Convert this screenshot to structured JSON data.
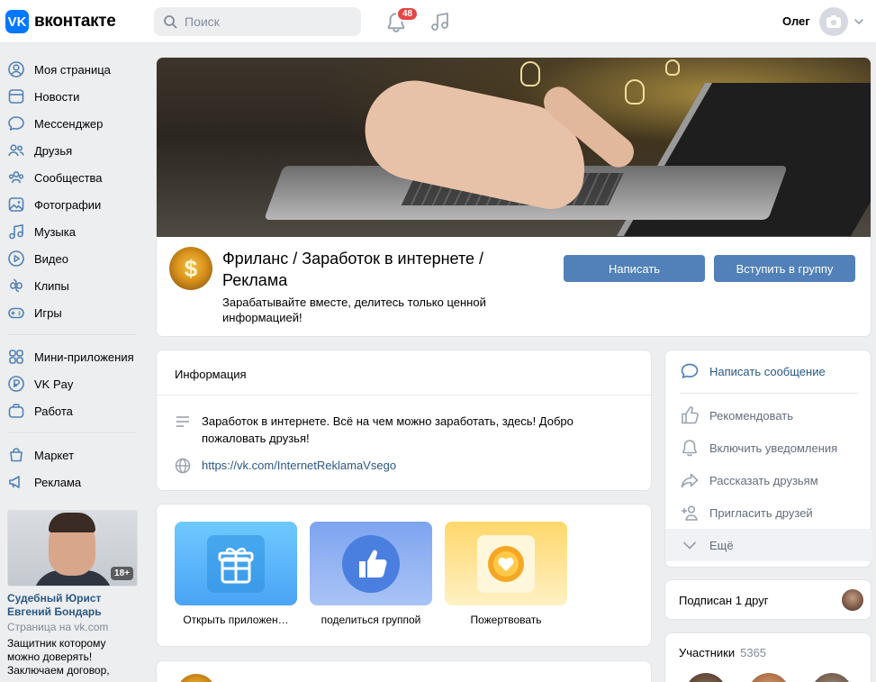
{
  "header": {
    "logo_mark": "VK",
    "logo_text": "вконтакте",
    "search_placeholder": "Поиск",
    "notifications_count": "48",
    "user_name": "Олег"
  },
  "sidebar": {
    "items": [
      {
        "label": "Моя страница",
        "icon": "user-circle-icon"
      },
      {
        "label": "Новости",
        "icon": "news-icon"
      },
      {
        "label": "Мессенджер",
        "icon": "chat-icon"
      },
      {
        "label": "Друзья",
        "icon": "friends-icon"
      },
      {
        "label": "Сообщества",
        "icon": "communities-icon"
      },
      {
        "label": "Фотографии",
        "icon": "photos-icon"
      },
      {
        "label": "Музыка",
        "icon": "music-icon"
      },
      {
        "label": "Видео",
        "icon": "video-icon"
      },
      {
        "label": "Клипы",
        "icon": "clips-icon"
      },
      {
        "label": "Игры",
        "icon": "gamepad-icon"
      }
    ],
    "items2": [
      {
        "label": "Мини-приложения",
        "icon": "mini-apps-icon"
      },
      {
        "label": "VK Pay",
        "icon": "vkpay-icon"
      },
      {
        "label": "Работа",
        "icon": "work-icon"
      }
    ],
    "items3": [
      {
        "label": "Маркет",
        "icon": "market-icon"
      },
      {
        "label": "Реклама",
        "icon": "ads-icon"
      }
    ],
    "ad": {
      "age_badge": "18+",
      "title": "Судебный Юрист Евгений Бондарь",
      "source": "Страница на vk.com",
      "text": "Защитник которому можно доверять! Заключаем договор,"
    }
  },
  "group": {
    "avatar_glyph": "$",
    "name": "Фриланс / Заработок в интернете / Реклама",
    "status": "Зарабатывайте вместе, делитесь только ценной информацией!",
    "write_button": "Написать",
    "join_button": "Вступить в группу"
  },
  "info": {
    "title": "Информация",
    "description": "Заработок в интернете. Всё на чем можно заработать, здесь! Добро пожаловать друзья!",
    "link": "https://vk.com/InternetReklamaVsego"
  },
  "apps": [
    {
      "label": "Открыть приложен…",
      "icon": "gift-icon"
    },
    {
      "label": "поделиться группой",
      "icon": "thumbs-up-icon"
    },
    {
      "label": "Пожертвовать",
      "icon": "heart-coin-icon"
    }
  ],
  "actions": {
    "primary": "Написать сообщение",
    "items": [
      {
        "label": "Рекомендовать",
        "icon": "like-icon"
      },
      {
        "label": "Включить уведомления",
        "icon": "bell-icon"
      },
      {
        "label": "Рассказать друзьям",
        "icon": "share-icon"
      },
      {
        "label": "Пригласить друзей",
        "icon": "invite-icon"
      },
      {
        "label": "Ещё",
        "icon": "chevron-down-icon"
      }
    ]
  },
  "friends": {
    "label": "Подписан 1 друг"
  },
  "members": {
    "title": "Участники",
    "count": "5365"
  },
  "colors": {
    "accent": "#5181b8",
    "link": "#2a5885",
    "brand": "#0077ff",
    "badge": "#e64646"
  }
}
